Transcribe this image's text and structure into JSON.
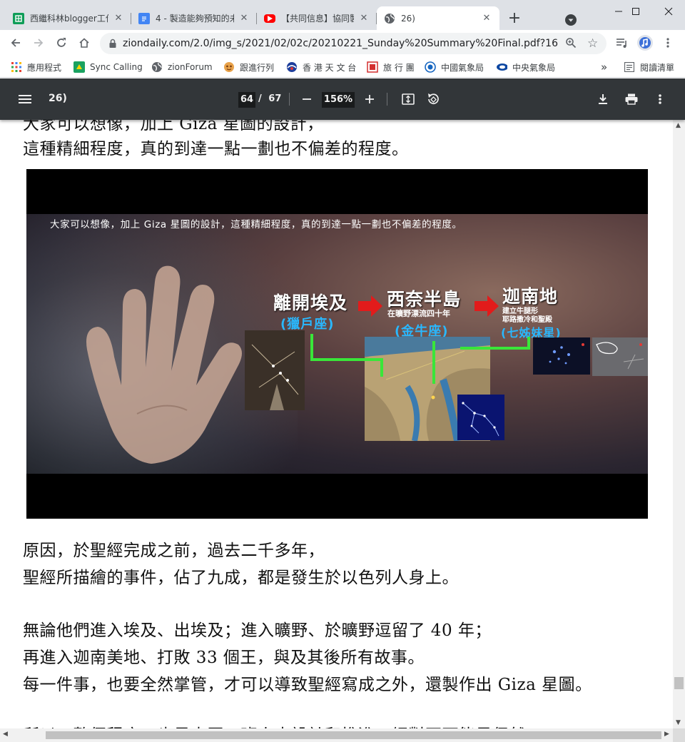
{
  "browser": {
    "tabs": [
      {
        "title": "西繼科林blogger工作",
        "icon": "sheets-icon",
        "color": "#0f9d58"
      },
      {
        "title": "4 - 製造能夠預知的未",
        "icon": "docs-icon",
        "color": "#4285f4"
      },
      {
        "title": "【共同信息】協同製作",
        "icon": "youtube-icon",
        "color": "#ff0000"
      },
      {
        "title": "26)",
        "icon": "globe-icon",
        "active": true
      }
    ],
    "new_tab_symbol": "+",
    "url": "ziondaily.com/2.0/img_s/2021/02/02c/20210221_Sunday%20Summary%20Final.pdf?1614...",
    "bookmarks": [
      {
        "label": "應用程式",
        "icon": "apps-grid-icon"
      },
      {
        "label": "Sync Calling",
        "icon": "sync-calling-icon"
      },
      {
        "label": "zionForum",
        "icon": "globe-icon"
      },
      {
        "label": "跟進行列",
        "icon": "follow-icon"
      },
      {
        "label": "香 港 天 文 台",
        "icon": "observatory-icon"
      },
      {
        "label": "旅 行 團",
        "icon": "travel-icon"
      },
      {
        "label": "中國氣象局",
        "icon": "cma-icon"
      },
      {
        "label": "中央氣象局",
        "icon": "cwb-icon"
      }
    ],
    "overflow_symbol": "»",
    "reading_list": "閱讀清單"
  },
  "pdf": {
    "title": "26)",
    "current_page": "64",
    "page_separator": "/",
    "total_pages": "67",
    "zoom": "156%"
  },
  "content": {
    "cut_top_line": "大家可以想像，加上 Giza 星圖的設計，",
    "line1": "這種精細程度，真的到達一點一劃也不偏差的程度。",
    "figure": {
      "caption": "大家可以想像，加上 Giza 星圖的設計，這種精細程度，真的到達一點一劃也不偏差的程度。",
      "stage1_main": "離開埃及",
      "stage1_sub": "(獵戶座)",
      "stage2_main": "西奈半島",
      "stage2_tag": "在曠野漂流四十年",
      "stage2_sub": "(金牛座)",
      "stage3_main": "迦南地",
      "stage3_tag1": "建立牛腿形",
      "stage3_tag2": "耶路撒冷和聖殿",
      "stage3_sub": "(七姊妹星)"
    },
    "para1_line1": "原因，於聖經完成之前，過去二千多年，",
    "para1_line2": "聖經所描繪的事件，佔了九成，都是發生於以色列人身上。",
    "para2_line1": "無論他們進入埃及、出埃及；進入曠野、於曠野逗留了 40 年；",
    "para2_line2": "再進入迦南美地、打敗 33 個王，與及其後所有故事。",
    "para2_line3": "每一件事，也要全然掌管，才可以導致聖經寫成之外，還製作出 Giza 星圖。",
    "cut_bottom_line": "所以，整個程序，也是由同一班人去設計和推進，絕對不可能是偶然。"
  },
  "colors": {
    "pdf_toolbar": "#323639",
    "arrow_red": "#e21b1b",
    "label_blue": "#29b8ff",
    "connector_green": "#39e639"
  }
}
